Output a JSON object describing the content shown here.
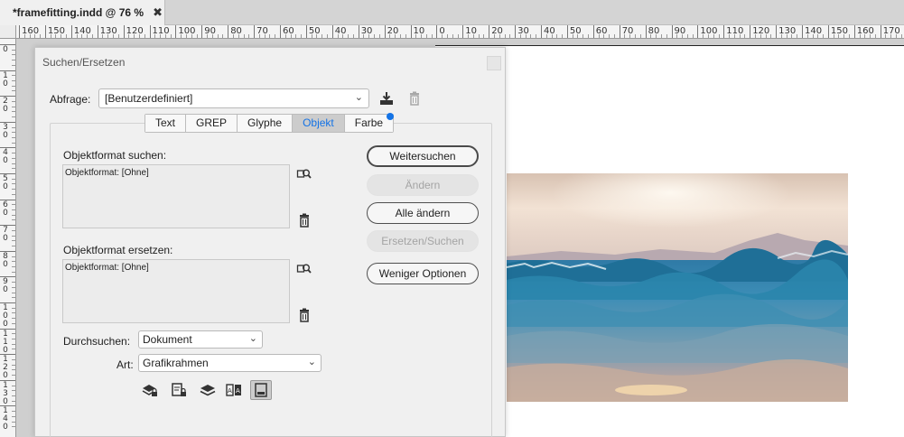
{
  "app": {
    "doc_tab": {
      "title": "*framefitting.indd @ 76 %",
      "close_glyph": "✖"
    }
  },
  "ruler": {
    "h_labels": [
      "160",
      "150",
      "140",
      "130",
      "120",
      "110",
      "100",
      "90",
      "80",
      "70",
      "60",
      "50",
      "40",
      "30",
      "20",
      "10",
      "0",
      "10",
      "20",
      "30",
      "40",
      "50",
      "60",
      "70",
      "80",
      "90",
      "100",
      "110",
      "120",
      "130",
      "140",
      "150",
      "160",
      "170"
    ],
    "v_labels": [
      "0",
      "1\n0",
      "2\n0",
      "3\n0",
      "4\n0",
      "5\n0",
      "6\n0",
      "7\n0",
      "8\n0",
      "9\n0",
      "1\n0\n0",
      "1\n1\n0",
      "1\n2\n0",
      "1\n3\n0",
      "1\n4\n0"
    ]
  },
  "dialog": {
    "title": "Suchen/Ersetzen",
    "query_label": "Abfrage:",
    "query_value": "[Benutzerdefiniert]",
    "tabs": [
      "Text",
      "GREP",
      "Glyphe",
      "Objekt",
      "Farbe"
    ],
    "active_tab": "Objekt",
    "find_label": "Objektformat suchen:",
    "find_value": "Objektformat: [Ohne]",
    "replace_label": "Objektformat ersetzen:",
    "replace_value": "Objektformat: [Ohne]",
    "buttons": {
      "find_next": "Weitersuchen",
      "change": "Ändern",
      "change_all": "Alle ändern",
      "change_find": "Ersetzen/Suchen",
      "fewer_options": "Weniger Optionen"
    },
    "search_label": "Durchsuchen:",
    "search_value": "Dokument",
    "type_label": "Art:",
    "type_value": "Grafikrahmen",
    "icons": {
      "save_query": "save-query-icon",
      "delete_query": "trash-icon",
      "find_format": "find-format-icon",
      "clear_format": "trash-icon",
      "option_icons": [
        "locked-layers-icon",
        "locked-items-icon",
        "hidden-layers-icon",
        "master-pages-icon",
        "footnotes-icon"
      ]
    }
  },
  "colors": {
    "accent": "#1473e6",
    "active_tab_bg": "#cccccc",
    "dialog_bg": "#f0f0f0"
  }
}
